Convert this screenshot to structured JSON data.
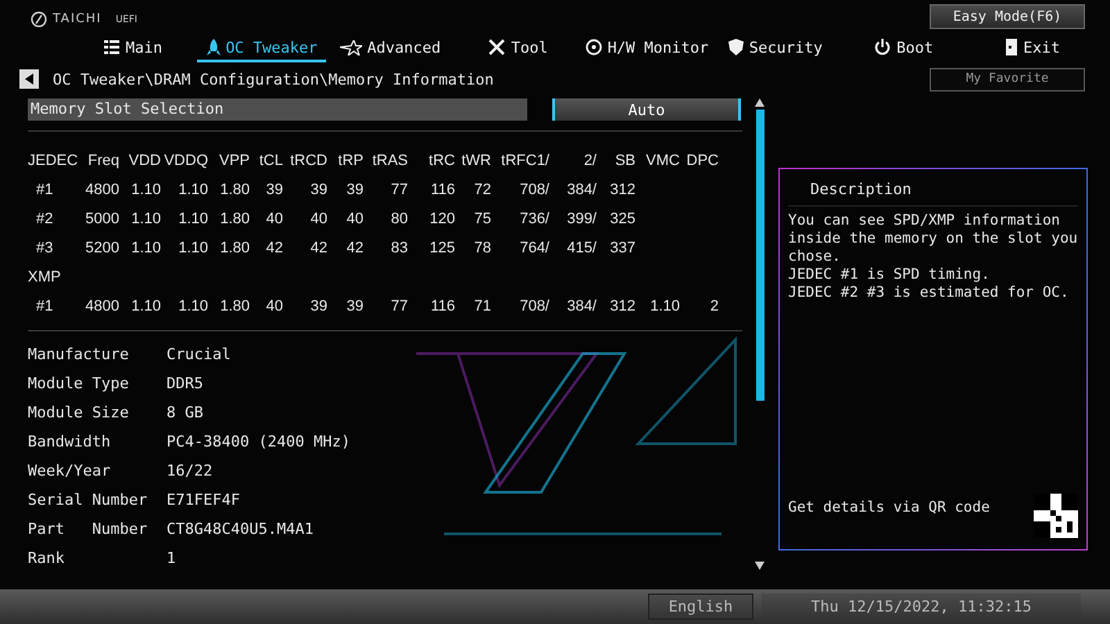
{
  "brand": {
    "name": "TAICHI",
    "suffix": "UEFI"
  },
  "easy_mode_button": "Easy Mode(F6)",
  "favorite_button": "My Favorite",
  "tabs": [
    {
      "label": "Main",
      "selected": false
    },
    {
      "label": "OC Tweaker",
      "selected": true
    },
    {
      "label": "Advanced",
      "selected": false
    },
    {
      "label": "Tool",
      "selected": false
    },
    {
      "label": "H/W Monitor",
      "selected": false
    },
    {
      "label": "Security",
      "selected": false
    },
    {
      "label": "Boot",
      "selected": false
    },
    {
      "label": "Exit",
      "selected": false
    }
  ],
  "breadcrumb": "OC Tweaker\\DRAM Configuration\\Memory Information",
  "setting": {
    "label": "Memory Slot Selection",
    "value": "Auto"
  },
  "timing_table": {
    "columns": [
      "JEDEC",
      "Freq",
      "VDD",
      "VDDQ",
      "VPP",
      "tCL",
      "tRCD",
      "tRP",
      "tRAS",
      "tRC",
      "tWR",
      "tRFC1/",
      "2/",
      "SB",
      "VMC",
      "DPC"
    ],
    "rows": [
      {
        "kind": "data",
        "cells": [
          "#1",
          "4800",
          "1.10",
          "1.10",
          "1.80",
          "39",
          "39",
          "39",
          "77",
          "116",
          "72",
          "708/",
          "384/",
          "312"
        ]
      },
      {
        "kind": "data",
        "cells": [
          "#2",
          "5000",
          "1.10",
          "1.10",
          "1.80",
          "40",
          "40",
          "40",
          "80",
          "120",
          "75",
          "736/",
          "399/",
          "325"
        ]
      },
      {
        "kind": "data",
        "cells": [
          "#3",
          "5200",
          "1.10",
          "1.10",
          "1.80",
          "42",
          "42",
          "42",
          "83",
          "125",
          "78",
          "764/",
          "415/",
          "337"
        ]
      },
      {
        "kind": "section",
        "cells": [
          "XMP"
        ]
      },
      {
        "kind": "data",
        "cells": [
          "#1",
          "4800",
          "1.10",
          "1.10",
          "1.80",
          "40",
          "39",
          "39",
          "77",
          "116",
          "71",
          "708/",
          "384/",
          "312",
          "1.10",
          "2"
        ]
      }
    ]
  },
  "info": [
    {
      "label": "Manufacture",
      "value": "Crucial"
    },
    {
      "label": "Module Type",
      "value": "DDR5"
    },
    {
      "label": "Module Size",
      "value": "8 GB"
    },
    {
      "label": "Bandwidth",
      "value": "PC4-38400 (2400 MHz)"
    },
    {
      "label": "Week/Year",
      "value": "16/22"
    },
    {
      "label": "Serial Number",
      "value": "E71FEF4F"
    },
    {
      "label": "Part   Number",
      "value": "CT8G48C40U5.M4A1"
    },
    {
      "label": "Rank",
      "value": "1"
    }
  ],
  "description": {
    "title": "Description",
    "lines": [
      "You can see SPD/XMP information inside the memory on the slot you chose.",
      "JEDEC #1 is SPD timing.",
      "JEDEC #2 #3 is estimated for OC."
    ],
    "qr_text": "Get details via QR code"
  },
  "status_bar": {
    "language": "English",
    "datetime": "Thu 12/15/2022, 11:32:15"
  }
}
